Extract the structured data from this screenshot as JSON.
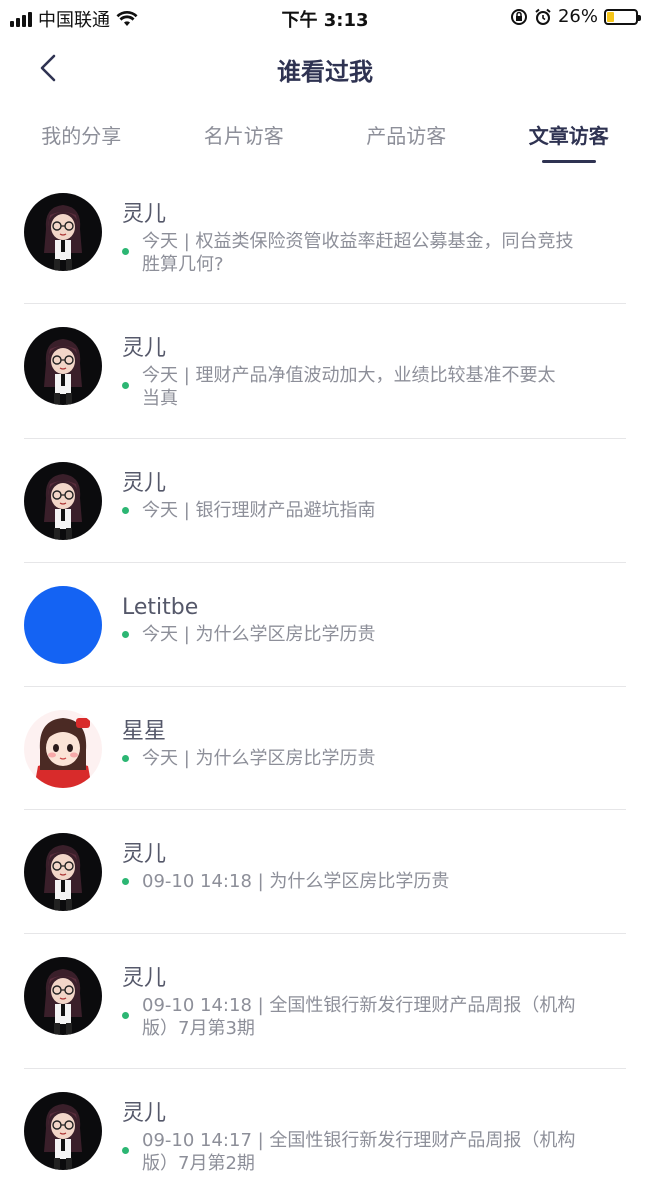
{
  "status_bar": {
    "carrier": "中国联通",
    "time": "下午 3:13",
    "battery_percent": "26%",
    "battery_level": 0.26
  },
  "nav": {
    "title": "谁看过我"
  },
  "tabs": [
    {
      "label": "我的分享"
    },
    {
      "label": "名片访客"
    },
    {
      "label": "产品访客"
    },
    {
      "label": "文章访客",
      "active": true
    }
  ],
  "visitors": [
    {
      "name": "灵儿",
      "avatar": "cartoon-girl-black",
      "line1": "今天 | 权益类保险资管收益率赶超公募基金，同台竞技",
      "line2": "胜算几何?"
    },
    {
      "name": "灵儿",
      "avatar": "cartoon-girl-black",
      "line1": "今天 | 理财产品净值波动加大，业绩比较基准不要太",
      "line2": "当真"
    },
    {
      "name": "灵儿",
      "avatar": "cartoon-girl-black",
      "line1": "今天 | 银行理财产品避坑指南",
      "line2": ""
    },
    {
      "name": "Letitbe",
      "avatar": "blue-circle",
      "line1": "今天 | 为什么学区房比学历贵",
      "line2": ""
    },
    {
      "name": "星星",
      "avatar": "cartoon-girl-red",
      "line1": "今天 | 为什么学区房比学历贵",
      "line2": ""
    },
    {
      "name": "灵儿",
      "avatar": "cartoon-girl-black",
      "line1": "09-10 14:18 | 为什么学区房比学历贵",
      "line2": ""
    },
    {
      "name": "灵儿",
      "avatar": "cartoon-girl-black",
      "line1": "09-10 14:18 | 全国性银行新发行理财产品周报（机构",
      "line2": "版）7月第3期"
    },
    {
      "name": "灵儿",
      "avatar": "cartoon-girl-black",
      "line1": "09-10 14:17 | 全国性银行新发行理财产品周报（机构",
      "line2": "版）7月第2期"
    }
  ],
  "colors": {
    "accent": "#2f3352",
    "online_dot": "#2cb673",
    "blue_avatar": "#1463f3"
  }
}
